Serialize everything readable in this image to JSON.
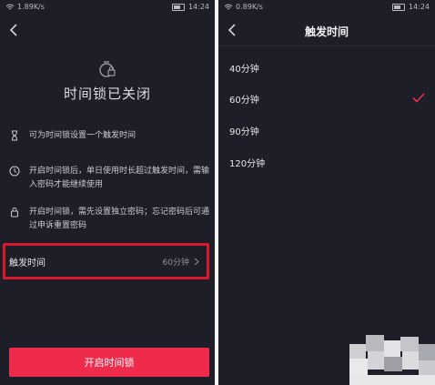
{
  "left": {
    "status": {
      "speed": "1.89K/s",
      "time": "14:24"
    },
    "hero_title": "时间锁已关闭",
    "tips": [
      {
        "icon": "hourglass-icon",
        "text": "可为时间锁设置一个触发时间"
      },
      {
        "icon": "clock-icon",
        "text": "开启时间锁后，单日使用时长超过触发时间，需输入密码才能继续使用"
      },
      {
        "icon": "lock-icon",
        "text": "开启时间锁，需先设置独立密码；忘记密码后可通过申诉重置密码"
      }
    ],
    "trigger_row": {
      "label": "触发时间",
      "value": "60分钟"
    },
    "start_button": "开启时间锁"
  },
  "right": {
    "status": {
      "speed": "0.89K/s",
      "time": "14:24"
    },
    "title": "触发时间",
    "options": [
      {
        "label": "40分钟",
        "selected": false
      },
      {
        "label": "60分钟",
        "selected": true
      },
      {
        "label": "90分钟",
        "selected": false
      },
      {
        "label": "120分钟",
        "selected": false
      }
    ]
  },
  "colors": {
    "background": "#1e1e28",
    "accent": "#ee2b4b",
    "highlight_border": "#d8192c"
  }
}
